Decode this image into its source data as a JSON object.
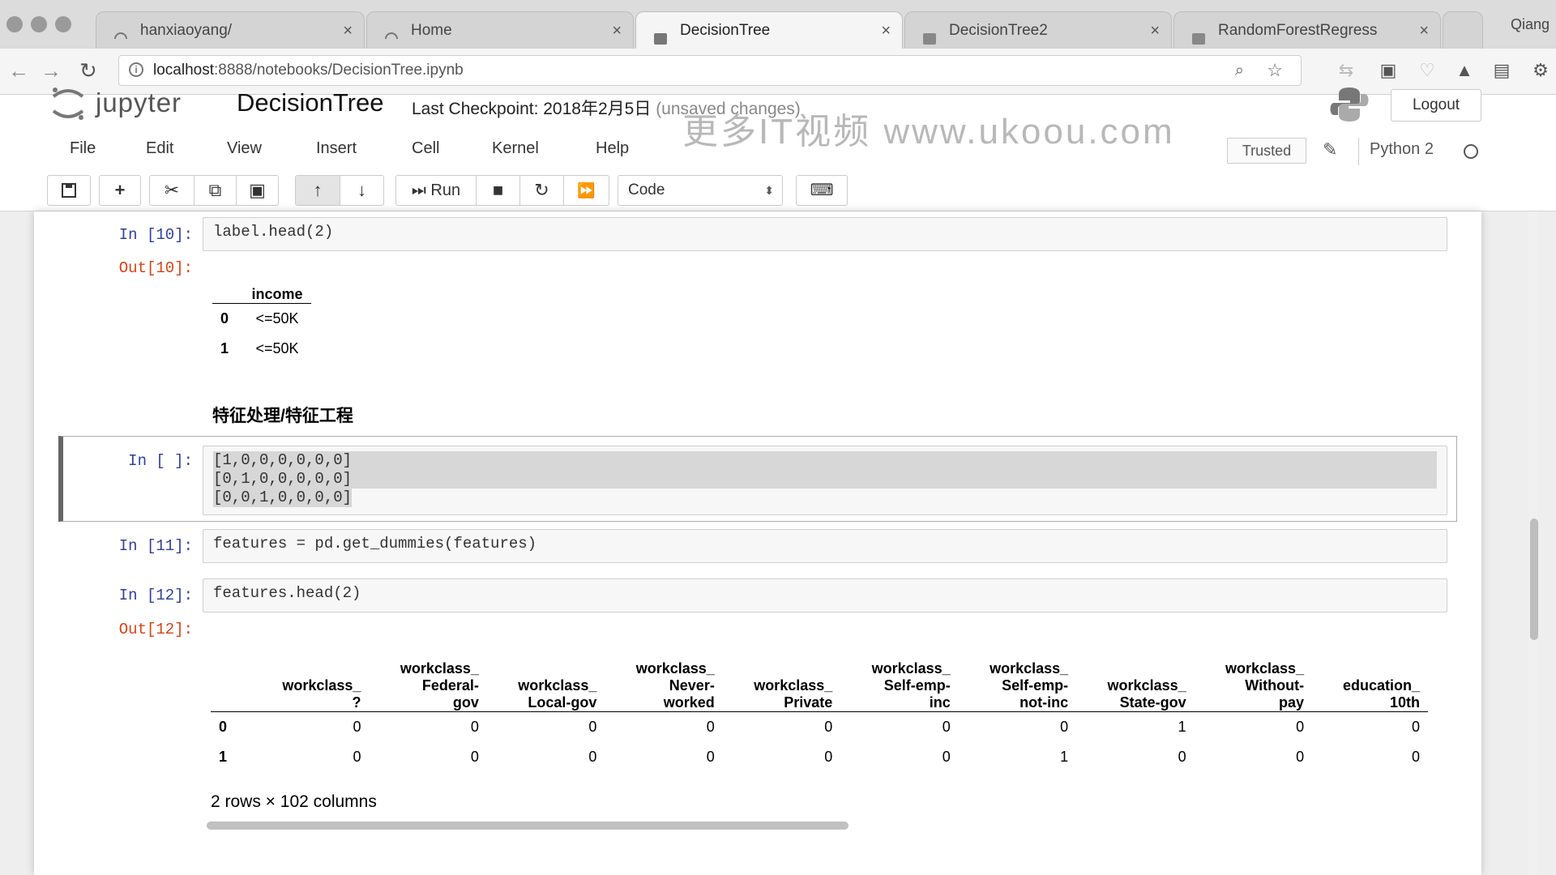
{
  "browser": {
    "tabs": [
      {
        "title": "hanxiaoyang/",
        "active": false
      },
      {
        "title": "Home",
        "active": false
      },
      {
        "title": "DecisionTree",
        "active": true
      },
      {
        "title": "DecisionTree2",
        "active": false
      },
      {
        "title": "RandomForestRegress",
        "active": false
      }
    ],
    "user": "Qiang",
    "url_host": "localhost",
    "url_rest": ":8888/notebooks/DecisionTree.ipynb"
  },
  "jupyter": {
    "logo_text": "jupyter",
    "notebook_name": "DecisionTree",
    "checkpoint": "Last Checkpoint: 2018年2月5日",
    "unsaved": "(unsaved changes)",
    "logout": "Logout",
    "watermark": "更多IT视频 www.ukoou.com",
    "menu": [
      "File",
      "Edit",
      "View",
      "Insert",
      "Cell",
      "Kernel",
      "Help"
    ],
    "trusted": "Trusted",
    "kernel": "Python 2",
    "toolbar": {
      "run": "Run",
      "cell_type": "Code"
    }
  },
  "cells": {
    "c10": {
      "prompt_in": "In [10]:",
      "code": "label.head(2)",
      "prompt_out": "Out[10]:"
    },
    "label_table": {
      "header": "income",
      "rows": [
        {
          "idx": "0",
          "val": "<=50K"
        },
        {
          "idx": "1",
          "val": "<=50K"
        }
      ]
    },
    "markdown": "特征处理/特征工程",
    "c_empty": {
      "prompt_in": "In [ ]:",
      "lines": [
        "[1,0,0,0,0,0,0]",
        "[0,1,0,0,0,0,0]",
        "[0,0,1,0,0,0,0]"
      ]
    },
    "c11": {
      "prompt_in": "In [11]:",
      "code": "features = pd.get_dummies(features)"
    },
    "c12": {
      "prompt_in": "In [12]:",
      "code": "features.head(2)",
      "prompt_out": "Out[12]:"
    },
    "features_table": {
      "headers": [
        [
          "workclass_",
          "?"
        ],
        [
          "workclass_",
          "Federal-",
          "gov"
        ],
        [
          "workclass_",
          "Local-gov"
        ],
        [
          "workclass_",
          "Never-",
          "worked"
        ],
        [
          "workclass_",
          "Private"
        ],
        [
          "workclass_",
          "Self-emp-",
          "inc"
        ],
        [
          "workclass_",
          "Self-emp-",
          "not-inc"
        ],
        [
          "workclass_",
          "State-gov"
        ],
        [
          "workclass_",
          "Without-",
          "pay"
        ],
        [
          "education_",
          "10th"
        ]
      ],
      "rows": [
        {
          "idx": "0",
          "vals": [
            "0",
            "0",
            "0",
            "0",
            "0",
            "0",
            "0",
            "1",
            "0",
            "0"
          ]
        },
        {
          "idx": "1",
          "vals": [
            "0",
            "0",
            "0",
            "0",
            "0",
            "0",
            "1",
            "0",
            "0",
            "0"
          ]
        }
      ],
      "shape": "2 rows × 102 columns"
    }
  }
}
